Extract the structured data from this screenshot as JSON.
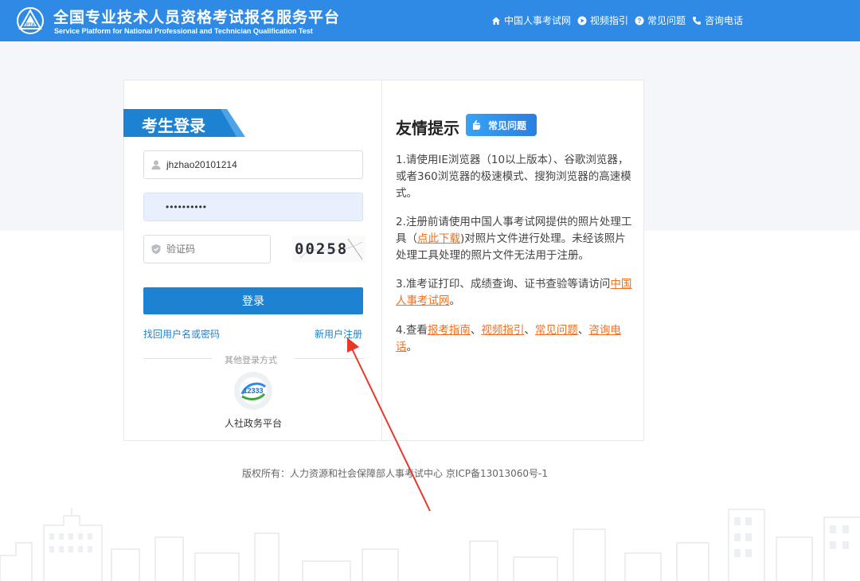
{
  "header": {
    "title_cn": "全国专业技术人员资格考试报名服务平台",
    "title_en": "Service Platform for National Professional and Technician Qualification Test",
    "logo_text": "PTA",
    "nav": [
      {
        "label": "中国人事考试网",
        "icon": "home-icon"
      },
      {
        "label": "视频指引",
        "icon": "play-icon"
      },
      {
        "label": "常见问题",
        "icon": "question-icon"
      },
      {
        "label": "咨询电话",
        "icon": "phone-icon"
      }
    ]
  },
  "login": {
    "tab_title": "考生登录",
    "username_value": "jhzhao20101214",
    "password_value": "••••••••••",
    "captcha_placeholder": "验证码",
    "captcha_text": "00258",
    "submit_label": "登录",
    "forgot_label": "找回用户名或密码",
    "register_label": "新用户注册",
    "other_methods_label": "其他登录方式",
    "gov_platform_label": "人社政务平台",
    "gov_logo_text": "12333"
  },
  "tips": {
    "title": "友情提示",
    "faq_badge": "常见问题",
    "tip1": "1.请使用IE浏览器（10以上版本）、谷歌浏览器，或者360浏览器的极速模式、搜狗浏览器的高速模式。",
    "tip2_prefix": "2.注册前请使用中国人事考试网提供的照片处理工具（",
    "tip2_link": "点此下载",
    "tip2_suffix": ")对照片文件进行处理。未经该照片处理工具处理的照片文件无法用于注册。",
    "tip3_prefix": "3.准考证打印、成绩查询、证书查验等请访问",
    "tip3_link": "中国人事考试网",
    "tip3_suffix": "。",
    "tip4_prefix": "4.查看",
    "tip4_link1": "报考指南",
    "tip4_sep1": "、",
    "tip4_link2": "视频指引",
    "tip4_sep2": "、",
    "tip4_link3": "常见问题",
    "tip4_sep3": "、",
    "tip4_link4": "咨询电话",
    "tip4_suffix": "。"
  },
  "footer": {
    "copyright": "版权所有：人力资源和社会保障部人事考试中心 京ICP备13013060号-1"
  },
  "colors": {
    "header_bg": "#2f8ae6",
    "primary_button": "#1d82d2",
    "link_orange": "#f07020",
    "annotation_arrow": "#e8372b"
  }
}
